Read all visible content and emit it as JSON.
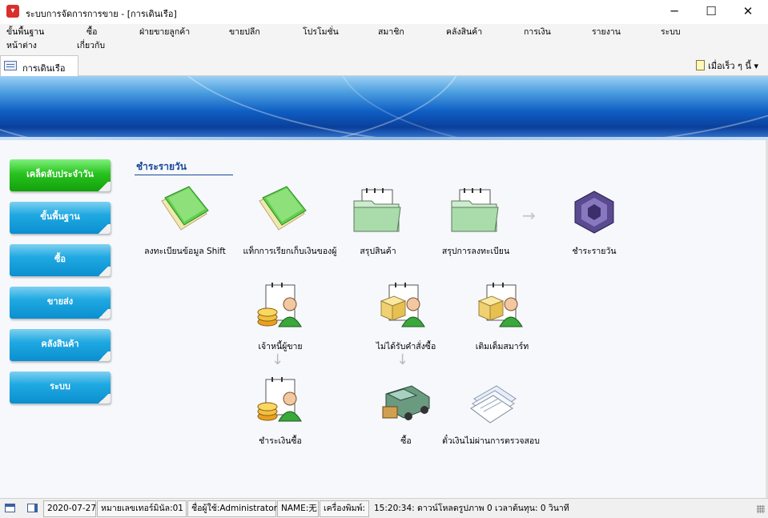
{
  "window": {
    "title": "ระบบการจัดการการขาย - [การเดินเรือ]",
    "minimize": "─",
    "maximize": "☐",
    "close": "✕"
  },
  "menu": {
    "items": [
      "ขั้นพื้นฐาน",
      "ซื้อ",
      "ฝ่ายขายลูกค้า",
      "ขายปลีก",
      "โปรโมชั่น",
      "สมาชิก",
      "คลังสินค้า",
      "การเงิน",
      "รายงาน",
      "ระบบ",
      "หน้าต่าง",
      "เกี่ยวกับ"
    ]
  },
  "tabs": {
    "active": "การเดินเรือ",
    "quick_menu": "เมื่อเร็ว ๆ นี้",
    "quick_caret": "▾"
  },
  "nav": {
    "items": [
      "เคล็ดลับประจำวัน",
      "ขั้นพื้นฐาน",
      "ซื้อ",
      "ขายส่ง",
      "คลังสินค้า",
      "ระบบ"
    ],
    "active_index": 0
  },
  "content": {
    "section_title": "ชำระรายวัน",
    "tiles": [
      {
        "label": "ลงทะเบียนข้อมูล Shift",
        "icon": "green-book-icon"
      },
      {
        "label": "แท็กการเรียกเก็บเงินของผู้",
        "icon": "green-book-icon"
      },
      {
        "label": "สรุปสินค้า",
        "icon": "folder-icon"
      },
      {
        "label": "สรุปการลงทะเบียน",
        "icon": "folder-icon"
      },
      {
        "label": "ชำระรายวัน",
        "icon": "gamecube-icon"
      },
      {
        "label": "เจ้าหนี้ผู้ขาย",
        "icon": "coins-user-icon"
      },
      {
        "label": "ไม่ได้รับคำสั่งซื้อ",
        "icon": "box-user-icon"
      },
      {
        "label": "เติมเต็มสมาร์ท",
        "icon": "box-user-icon"
      },
      {
        "label": "ชำระเงินซื้อ",
        "icon": "coins-user-icon"
      },
      {
        "label": "ซื้อ",
        "icon": "truck-icon"
      },
      {
        "label": "ตั๋วเงินไม่ผ่านการตรวจสอบ",
        "icon": "documents-icon"
      }
    ],
    "arrow_right": "→",
    "arrow_down": "↓"
  },
  "status": {
    "date": "2020-07-27",
    "register": "หมายเลขเทอร์มินัล:01",
    "user": "ชื่อผู้ใช้:Administrator",
    "name": "NAME:无",
    "printer": "เครื่องพิมพ์:",
    "time": "15:20:34: ดาวน์โหลดรูปภาพ 0 เวลาต้นทุน: 0 วินาที"
  },
  "colors": {
    "banner_dark": "#0a3f9a",
    "nav_blue": "#0a8fcf",
    "nav_green": "#13a10c",
    "section_title": "#1a4a9a"
  }
}
